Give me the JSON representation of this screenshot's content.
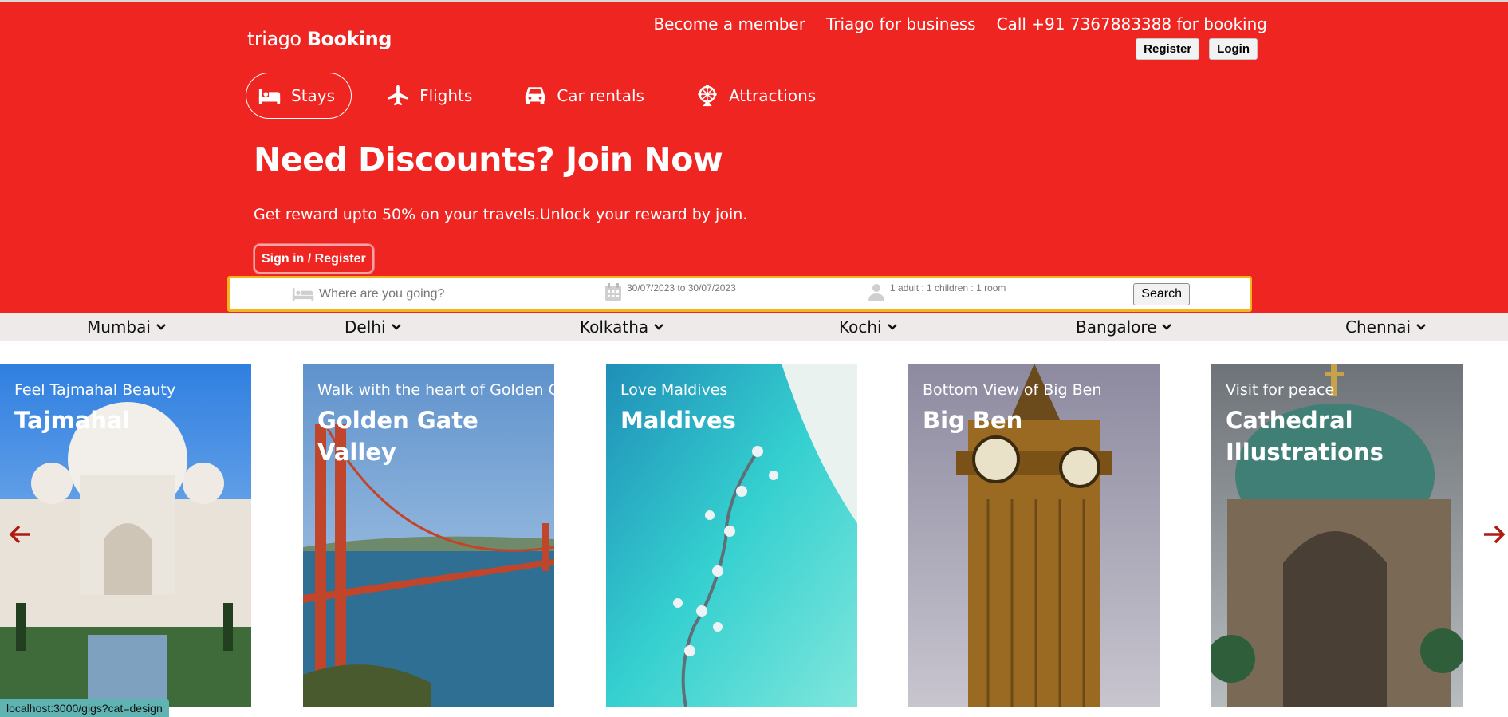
{
  "brand": {
    "name": "triago",
    "product": "Booking"
  },
  "top_links": [
    "Become a member",
    "Triago for business",
    "Call +91 7367883388 for booking"
  ],
  "auth": {
    "register": "Register",
    "login": "Login"
  },
  "nav": [
    {
      "label": "Stays",
      "icon": "bed-icon",
      "active": true
    },
    {
      "label": "Flights",
      "icon": "plane-icon",
      "active": false
    },
    {
      "label": "Car rentals",
      "icon": "car-icon",
      "active": false
    },
    {
      "label": "Attractions",
      "icon": "ferris-wheel-icon",
      "active": false
    }
  ],
  "hero": {
    "title": "Need Discounts? Join Now",
    "subtitle": "Get reward upto 50% on your travels.Unlock your reward by join.",
    "cta": "Sign in / Register"
  },
  "search": {
    "destination_placeholder": "Where are you going?",
    "dates": "30/07/2023 to 30/07/2023",
    "guests": "1 adult : 1 children : 1 room",
    "button": "Search"
  },
  "cities": [
    "Mumbai",
    "Delhi",
    "Kolkatha",
    "Kochi",
    "Bangalore",
    "Chennai"
  ],
  "cards": [
    {
      "subtitle": "Feel Tajmahal Beauty",
      "title": "Tajmahal"
    },
    {
      "subtitle": "Walk with the heart of Golden Gate",
      "title": "Golden Gate Valley"
    },
    {
      "subtitle": "Love Maldives",
      "title": "Maldives"
    },
    {
      "subtitle": "Bottom View of Big Ben",
      "title": "Big Ben"
    },
    {
      "subtitle": "Visit for peace",
      "title": "Cathedral Illustrations"
    }
  ],
  "status_url": "localhost:3000/gigs?cat=design",
  "colors": {
    "brand_red": "#ef2522",
    "search_border": "#f4b41a",
    "arrow": "#b01a12",
    "city_bar": "#eeeaea"
  }
}
